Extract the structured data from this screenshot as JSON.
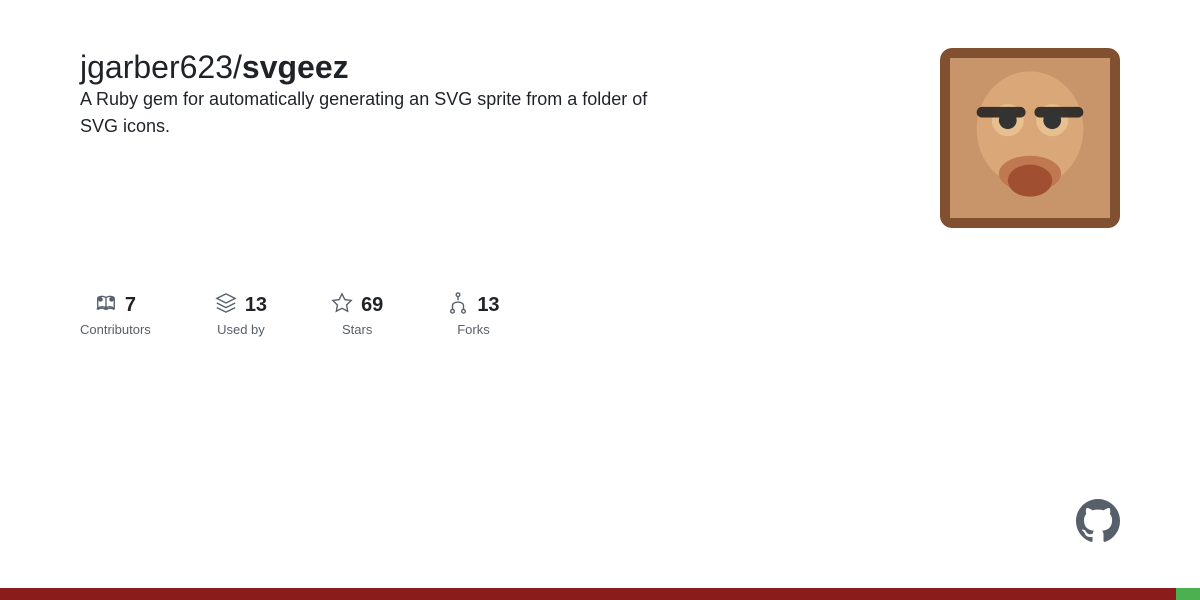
{
  "repo": {
    "owner": "jgarber623",
    "name": "svgeez",
    "description": "A Ruby gem for automatically generating an SVG sprite from a folder of SVG icons.",
    "avatar_alt": "Repository owner avatar"
  },
  "stats": {
    "contributors": {
      "count": "7",
      "label": "Contributors"
    },
    "used_by": {
      "count": "13",
      "label": "Used by"
    },
    "stars": {
      "count": "69",
      "label": "Stars"
    },
    "forks": {
      "count": "13",
      "label": "Forks"
    }
  },
  "bottom_bar": {
    "color_main": "#8b1c1c",
    "color_accent": "#4caf50"
  }
}
